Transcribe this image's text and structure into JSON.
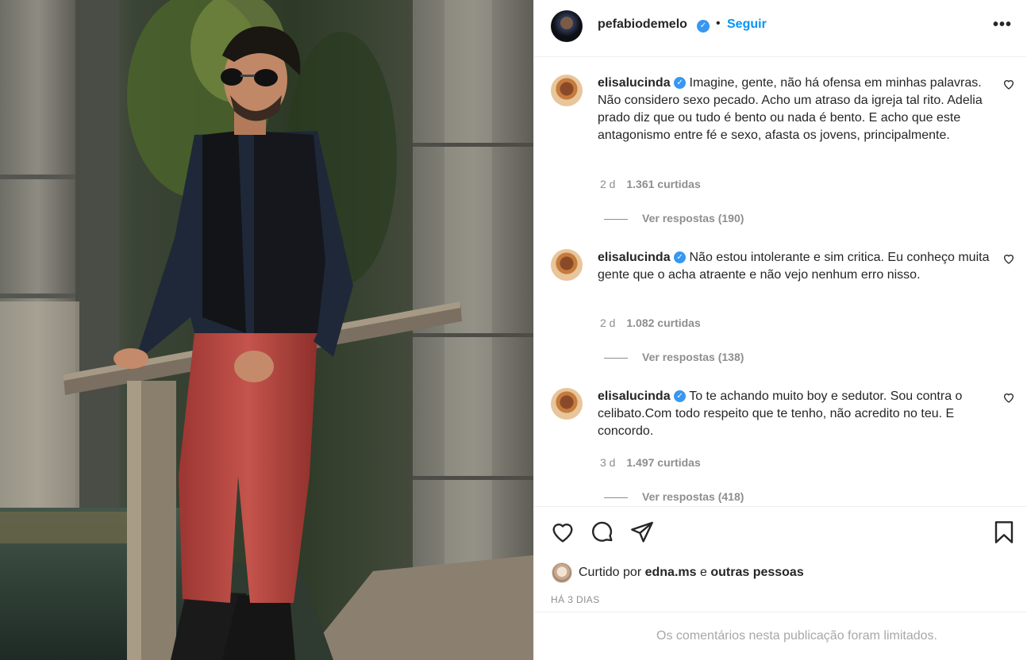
{
  "post": {
    "username": "pefabiodemelo",
    "separator": "•",
    "follow_label": "Seguir",
    "more_label": "•••"
  },
  "comments": [
    {
      "username": "elisalucinda",
      "text": "Imagine, gente, não há ofensa em minhas palavras. Não considero sexo pecado. Acho um atraso da igreja tal rito. Adelia prado diz que ou tudo é bento ou nada é bento. E acho que este antagonismo entre fé e sexo, afasta os jovens, principalmente.",
      "time": "2 d",
      "likes": "1.361 curtidas",
      "replies": "Ver respostas (190)"
    },
    {
      "username": "elisalucinda",
      "text": "Não estou intolerante e sim critica. Eu conheço muita gente que o acha atraente e não vejo nenhum erro nisso.",
      "time": "2 d",
      "likes": "1.082 curtidas",
      "replies": "Ver respostas (138)"
    },
    {
      "username": "elisalucinda",
      "text": "To te achando muito boy e sedutor. Sou contra o celibato.Com todo respeito que te tenho, não acredito no teu. E concordo.",
      "time": "3 d",
      "likes": "1.497 curtidas",
      "replies": "Ver respostas (418)"
    }
  ],
  "liked_by": {
    "prefix": "Curtido por",
    "user": "edna.ms",
    "connector": "e",
    "others": "outras pessoas"
  },
  "post_date": "HÁ 3 DIAS",
  "comments_limited": "Os comentários nesta publicação foram limitados.",
  "icons": {
    "verified": "verified-badge-icon",
    "like": "heart-icon",
    "comment": "comment-bubble-icon",
    "share": "paper-plane-icon",
    "save": "bookmark-icon"
  },
  "colors": {
    "accent": "#0095f6",
    "verified": "#3897f0",
    "muted": "#8e8e8e",
    "text": "#262626",
    "jeans": "#b5453f"
  }
}
